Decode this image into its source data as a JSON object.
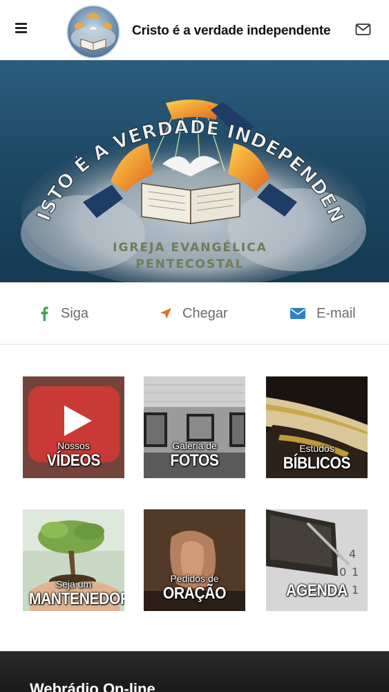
{
  "header": {
    "title": "Cristo é a verdade independente",
    "menu_icon": "hamburger-menu-icon",
    "mail_icon": "envelope-icon"
  },
  "banner": {
    "arc_text": "CRISTO É A VERDADE INDEPENDENTE",
    "line1": "IGREJA EVANGÉLICA",
    "line2": "PENTECOSTAL"
  },
  "actions": [
    {
      "label": "Siga",
      "icon": "facebook-icon",
      "color": "#3aa655"
    },
    {
      "label": "Chegar",
      "icon": "navigation-arrow-icon",
      "color": "#e2742a"
    },
    {
      "label": "E-mail",
      "icon": "envelope-icon",
      "color": "#2f7fc6"
    }
  ],
  "tiles": [
    {
      "small": "Nossos",
      "big": "VÍDEOS"
    },
    {
      "small": "Galeria de",
      "big": "FOTOS"
    },
    {
      "small": "Estudos",
      "big": "BÍBLICOS"
    },
    {
      "small": "Seja um",
      "big": "MANTENEDOR"
    },
    {
      "small": "Pedidos de",
      "big": "ORAÇÃO"
    },
    {
      "small": "",
      "big": "AGENDA"
    }
  ],
  "radio": {
    "title": "Webrádio On-line"
  },
  "colors": {
    "banner_bg": "#1e4965",
    "text_gray": "#6b6b6b"
  }
}
